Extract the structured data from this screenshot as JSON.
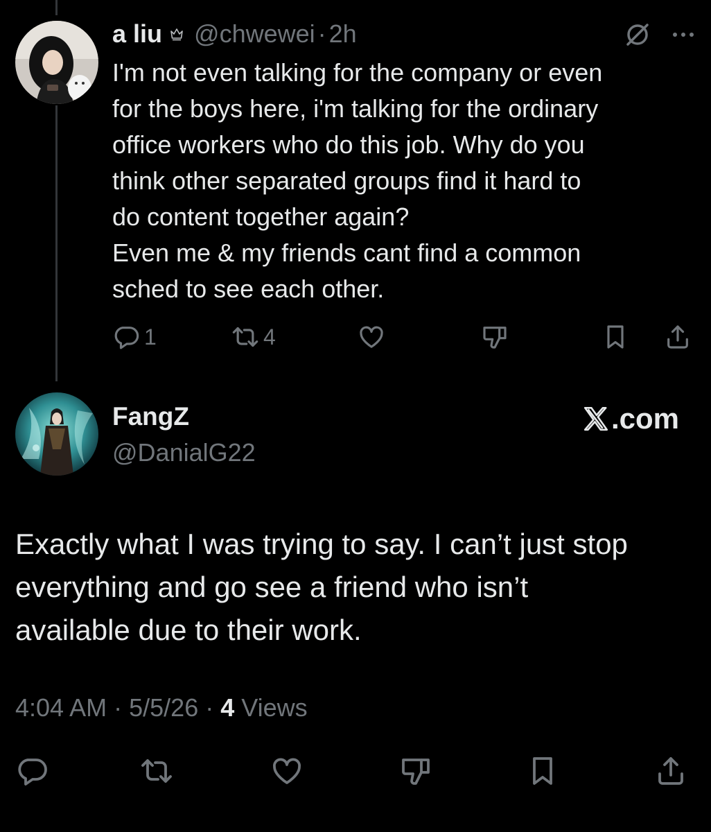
{
  "reply_tweet": {
    "display_name": "a liu",
    "handle": "@chwewei",
    "separator": "·",
    "time": "2h",
    "text_lines": [
      "I'm not even talking for the company or even",
      "for the boys here, i'm talking for the ordinary",
      "office workers who do this job. Why do you",
      "think other separated groups find it hard to",
      "do content together again?",
      "Even me & my friends cant find a common",
      "sched to see each other."
    ],
    "actions": {
      "reply_count": "1",
      "repost_count": "4",
      "like_count": "",
      "icons": [
        "reply-icon",
        "repost-icon",
        "like-icon",
        "dislike-icon",
        "bookmark-icon",
        "share-icon"
      ]
    }
  },
  "main_tweet": {
    "display_name": "FangZ",
    "handle": "@DanialG22",
    "watermark": ".com",
    "text_lines": [
      "Exactly what I was trying to say. I can’t just stop",
      "everything and go see a friend who isn’t",
      "available due to their work."
    ],
    "meta": {
      "time": "4:04 AM",
      "separator": "·",
      "date": "5/5/26",
      "views_count": "4",
      "views_label": "Views"
    },
    "icons": [
      "reply-icon",
      "repost-icon",
      "like-icon",
      "dislike-icon",
      "bookmark-icon",
      "share-icon"
    ]
  },
  "colors": {
    "background": "#000000",
    "text": "#e7e9ea",
    "muted": "#71767b",
    "thread_line": "#333639"
  }
}
